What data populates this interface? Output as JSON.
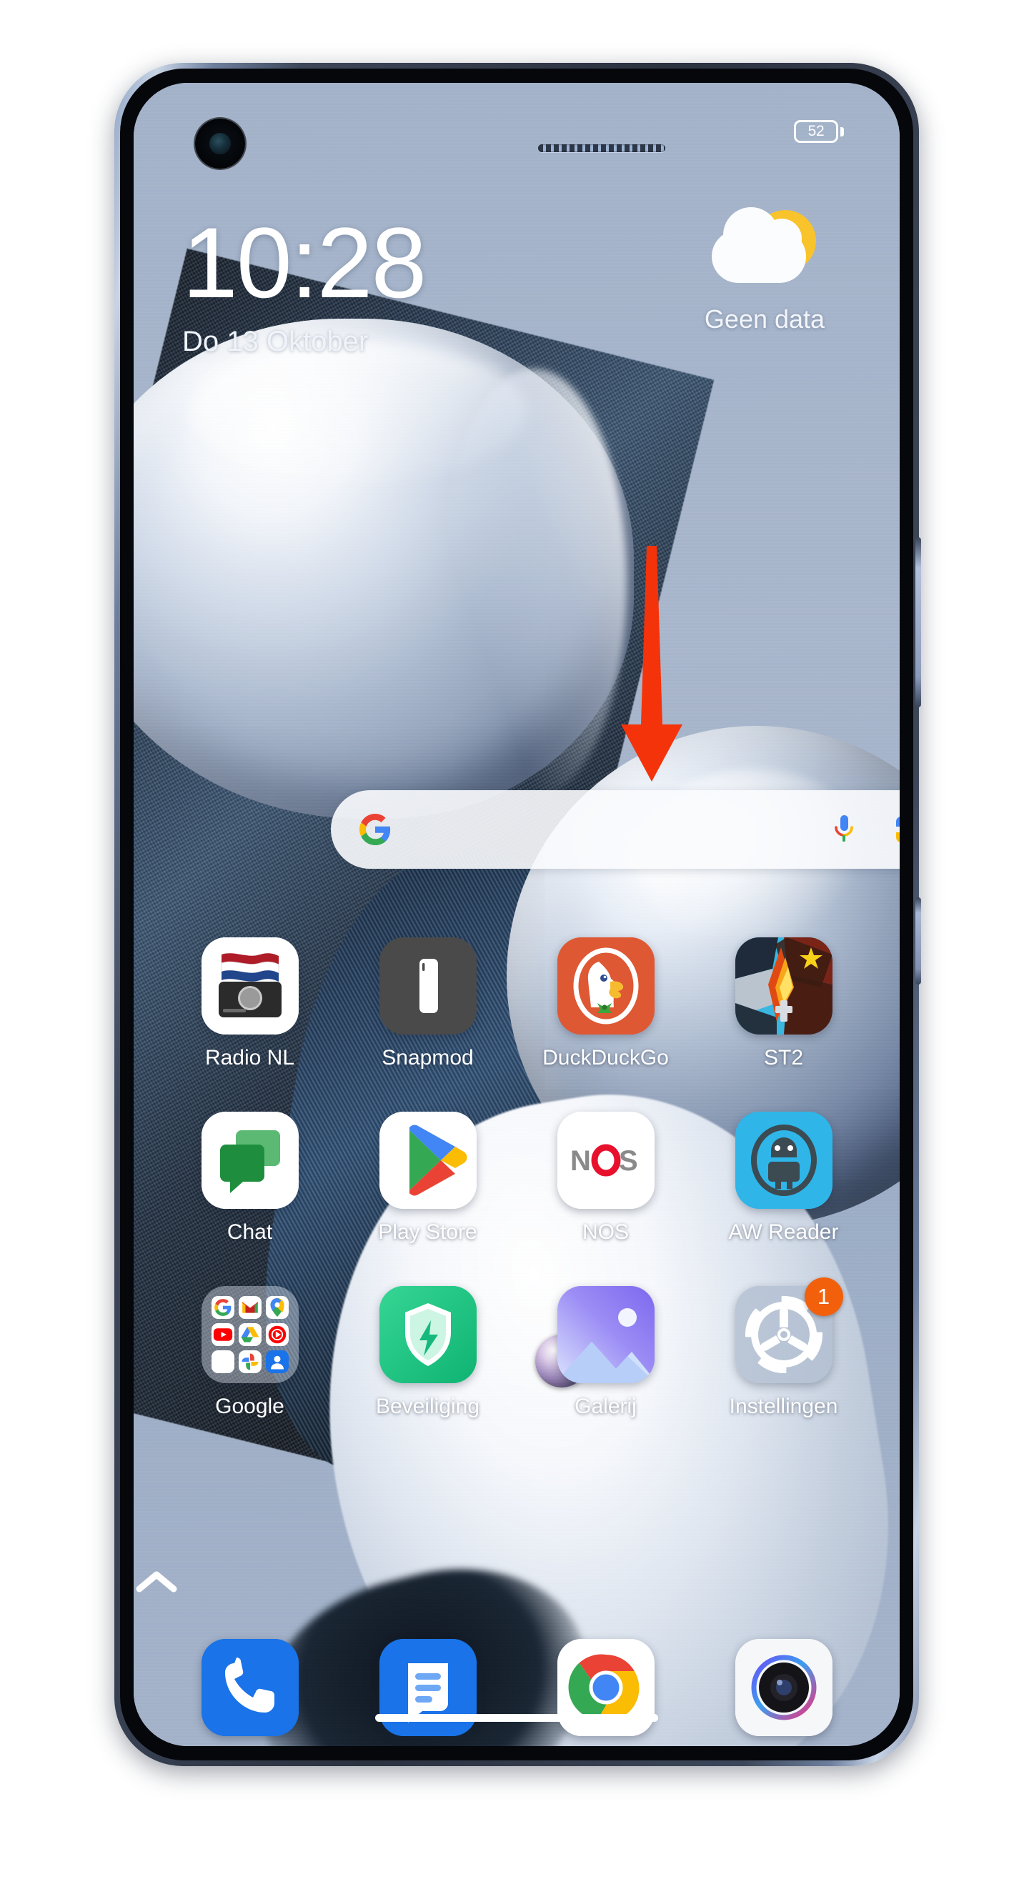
{
  "device": {
    "name": "xiaomi-phone",
    "frame_color": "#2b3240",
    "accent_red": "#f4330a",
    "badge_color": "#f2600c"
  },
  "statusbar": {
    "battery_level": "52",
    "battery_icon": "battery-icon",
    "camera_icon": "front-camera-punch-hole",
    "earpiece_icon": "earpiece-speaker-grille"
  },
  "clock_widget": {
    "time": "10:28",
    "date": "Do 13 Oktober"
  },
  "weather_widget": {
    "icon": "sun-behind-cloud-icon",
    "status": "Geen data"
  },
  "annotation": {
    "type": "red-down-arrow",
    "color": "#f4330a",
    "direction": "down"
  },
  "search": {
    "placeholder": "",
    "value": "",
    "google_icon": "google-g-icon",
    "mic_icon": "microphone-icon",
    "lens_icon": "google-lens-camera-icon"
  },
  "app_grid": {
    "rows": [
      [
        {
          "label": "Radio NL",
          "icon": "radio-nl-icon"
        },
        {
          "label": "Snapmod",
          "icon": "snapmod-icon"
        },
        {
          "label": "DuckDuckGo",
          "icon": "duckduckgo-icon"
        },
        {
          "label": "ST2",
          "icon": "st2-game-icon"
        }
      ],
      [
        {
          "label": "Chat",
          "icon": "google-chat-icon"
        },
        {
          "label": "Play Store",
          "icon": "play-store-icon"
        },
        {
          "label": "NOS",
          "icon": "nos-icon"
        },
        {
          "label": "AW Reader",
          "icon": "aw-reader-icon"
        }
      ],
      [
        {
          "label": "Google",
          "icon": "google-folder-icon",
          "badge": ""
        },
        {
          "label": "Beveiliging",
          "icon": "security-shield-icon"
        },
        {
          "label": "Galerij",
          "icon": "gallery-icon"
        },
        {
          "label": "Instellingen",
          "icon": "settings-gear-icon",
          "badge": "1"
        }
      ]
    ],
    "folder_apps": [
      "google-search-icon",
      "gmail-icon",
      "google-maps-icon",
      "youtube-icon",
      "google-drive-icon",
      "youtube-music-icon",
      "google-meet-icon",
      "google-photos-icon",
      "google-contacts-icon"
    ]
  },
  "app_drawer_handle": {
    "icon": "chevron-up-icon"
  },
  "dock": {
    "items": [
      {
        "label": "Phone",
        "icon": "phone-dialer-icon"
      },
      {
        "label": "Messages",
        "icon": "messages-icon"
      },
      {
        "label": "Chrome",
        "icon": "chrome-icon"
      },
      {
        "label": "Camera",
        "icon": "camera-icon"
      }
    ]
  },
  "navigation": {
    "gesture_bar": "home-gesture-bar"
  }
}
